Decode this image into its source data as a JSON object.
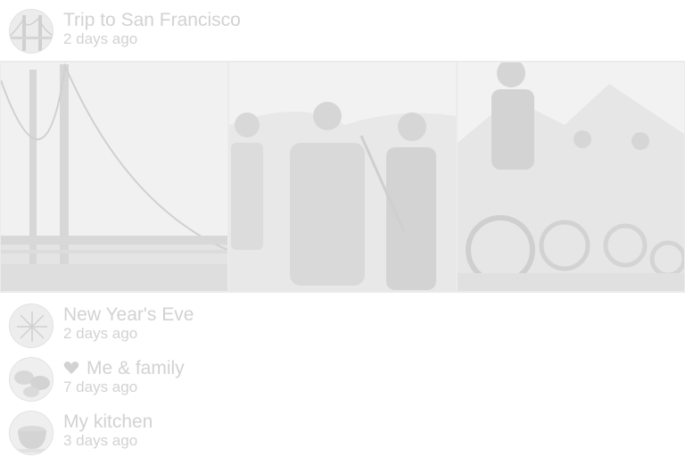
{
  "albums": [
    {
      "title": "Trip to San Francisco",
      "subtitle": "2 days ago",
      "avatar_icon": "golden-gate-bridge"
    },
    {
      "title": "New Year's Eve",
      "subtitle": "2 days ago",
      "avatar_icon": "sparkler"
    },
    {
      "title": "Me & family",
      "subtitle": "7 days ago",
      "avatar_icon": "hands",
      "badge_icon": "heart-icon"
    },
    {
      "title": "My kitchen",
      "subtitle": "3 days ago",
      "avatar_icon": "cup"
    }
  ],
  "expanded_photos": [
    {
      "subject": "golden-gate-bridge"
    },
    {
      "subject": "family-hiking"
    },
    {
      "subject": "mountain-bikers"
    }
  ],
  "colors": {
    "text": "#d2d2d2",
    "photo_bg": "#efefef",
    "strip_bg": "#ebebeb"
  }
}
